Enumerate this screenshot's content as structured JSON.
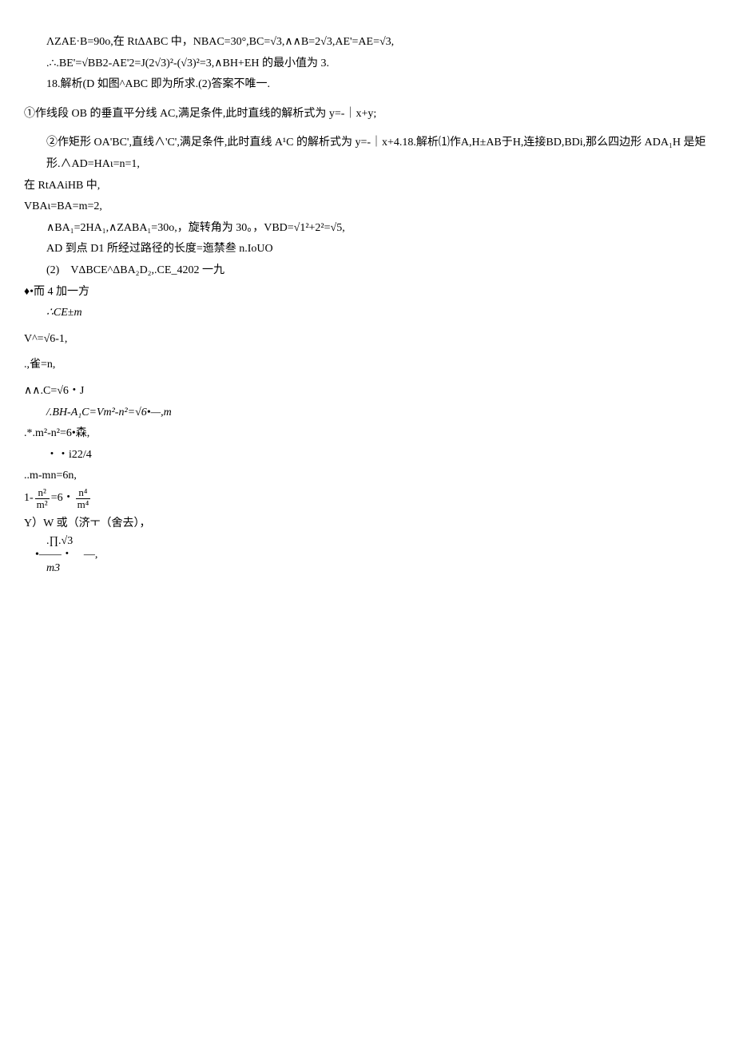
{
  "lines": {
    "l1": "ΛZAE·B=90o,在 RtΔABC 中，NBAC=30°,BC=√3,∧∧B=2√3,AE'=AE=√3,",
    "l2": ".∴.BE'=√BB2-AE'2=J(2√3)²-(√3)²=3,∧BH+EH 的最小值为 3.",
    "l3": "18.解析(D 如图^ABC 即为所求.(2)答案不唯一.",
    "l4": "①作线段 OB 的垂直平分线 AC,满足条件,此时直线的解析式为 y=-｜x+y;",
    "l5": "②作矩形 OA'BC',直线∧'C',满足条件,此时直线 A¹C 的解析式为 y=-｜x+4.18.解析⑴作A,H±AB于H,连接BD,BDi,那么四边形 ADA₁H 是矩形.∧AD=HAι=n=1,",
    "l6": "在 RtAAiHB 中,",
    "l7": "VBAι=BA=m=2,",
    "l8": "∧BA₁=2HA₁,∧ZABA₁=30o,，旋转角为 30。，VBD=√1²+2²=√5,",
    "l9": "AD 到点 D1 所经过路径的长度=迤禁叁 n.IoUO",
    "l10": "(2)　VΔBCE^ΔBA₂D₂,.CE_4202 一九",
    "l11": "♦•而 4 加一方",
    "l12": "∴CE±m",
    "l13": "V^=√6-1,",
    "l14": ".,雀=n,",
    "l15": "∧∧.C=√6・J",
    "l16": "/.BH-A₁C=Vm²-n²=√6•—,m",
    "l17": ".*.m²-n²=6•森,",
    "l18": "・・i22/4",
    "l19": "..m-mn=6n,",
    "eq_lhs_num": "n²",
    "eq_lhs_den": "m²",
    "eq_mid": "=6・",
    "eq_rhs_num": "n⁴",
    "eq_rhs_den": "m⁴",
    "eq_pre": "1-",
    "l21": "Y）W 或（济ㅜ（舍去），",
    "l22_top": ".∏.√3",
    "l22_mid": "•——・　—,",
    "l22_bot": "m3"
  }
}
